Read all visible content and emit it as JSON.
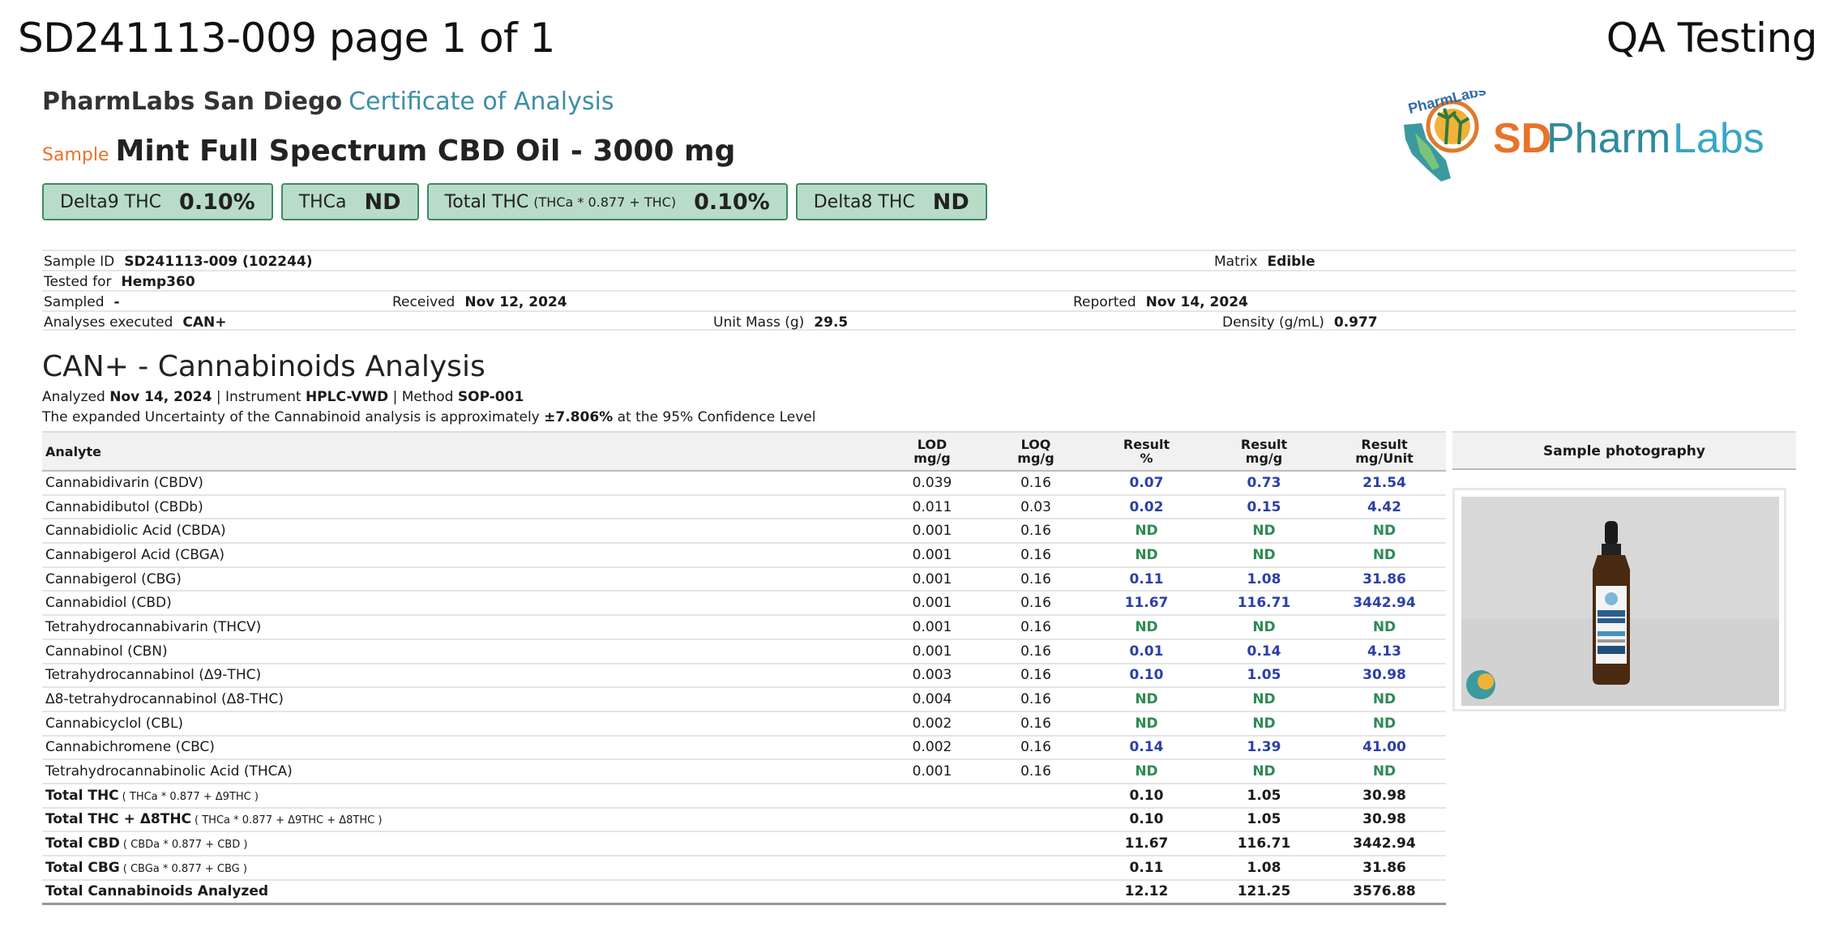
{
  "header": {
    "doc_id": "SD241113-009 page 1 of 1",
    "qa": "QA Testing"
  },
  "lab": {
    "name": "PharmLabs San Diego",
    "doc_type": "Certificate of Analysis"
  },
  "logo": {
    "text_sd": "SD",
    "text_pharm": "Pharm",
    "text_labs": "Labs",
    "small_text": "PharmLabs"
  },
  "sample": {
    "tag": "Sample",
    "name": "Mint Full Spectrum CBD Oil - 3000 mg"
  },
  "badges": [
    {
      "label": "Delta9 THC",
      "formula": "",
      "value": "0.10%"
    },
    {
      "label": "THCa",
      "formula": "",
      "value": "ND"
    },
    {
      "label": "Total THC",
      "formula": "(THCa * 0.877 + THC)",
      "value": "0.10%"
    },
    {
      "label": "Delta8 THC",
      "formula": "",
      "value": "ND"
    }
  ],
  "info": {
    "sample_id_label": "Sample ID",
    "sample_id": "SD241113-009 (102244)",
    "matrix_label": "Matrix",
    "matrix": "Edible",
    "tested_for_label": "Tested for",
    "tested_for": "Hemp360",
    "sampled_label": "Sampled",
    "sampled": "-",
    "received_label": "Received",
    "received": "Nov 12, 2024",
    "reported_label": "Reported",
    "reported": "Nov 14, 2024",
    "analyses_label": "Analyses executed",
    "analyses": "CAN+",
    "unit_mass_label": "Unit Mass (g)",
    "unit_mass": "29.5",
    "density_label": "Density (g/mL)",
    "density": "0.977"
  },
  "analysis": {
    "title": "CAN+ - Cannabinoids Analysis",
    "analyzed_label": "Analyzed",
    "analyzed": "Nov 14, 2024",
    "instrument_label": "|  Instrument",
    "instrument": "HPLC-VWD",
    "method_label": "| Method",
    "method": "SOP-001",
    "uncertainty_pre": "The expanded Uncertainty of the Cannabinoid analysis is approximately",
    "uncertainty_value": "±7.806%",
    "uncertainty_post": "at the 95% Confidence Level"
  },
  "table": {
    "headers": {
      "analyte": "Analyte",
      "lod_1": "LOD",
      "lod_2": "mg/g",
      "loq_1": "LOQ",
      "loq_2": "mg/g",
      "pct_1": "Result",
      "pct_2": "%",
      "mgg_1": "Result",
      "mgg_2": "mg/g",
      "mgu_1": "Result",
      "mgu_2": "mg/Unit",
      "photo": "Sample photography"
    },
    "rows": [
      {
        "name": "Cannabidivarin (CBDV)",
        "lod": "0.039",
        "loq": "0.16",
        "pct": "0.07",
        "mgg": "0.73",
        "mgu": "21.54"
      },
      {
        "name": "Cannabidibutol (CBDb)",
        "lod": "0.011",
        "loq": "0.03",
        "pct": "0.02",
        "mgg": "0.15",
        "mgu": "4.42"
      },
      {
        "name": "Cannabidiolic Acid (CBDA)",
        "lod": "0.001",
        "loq": "0.16",
        "pct": "ND",
        "mgg": "ND",
        "mgu": "ND"
      },
      {
        "name": "Cannabigerol Acid (CBGA)",
        "lod": "0.001",
        "loq": "0.16",
        "pct": "ND",
        "mgg": "ND",
        "mgu": "ND"
      },
      {
        "name": "Cannabigerol (CBG)",
        "lod": "0.001",
        "loq": "0.16",
        "pct": "0.11",
        "mgg": "1.08",
        "mgu": "31.86"
      },
      {
        "name": "Cannabidiol (CBD)",
        "lod": "0.001",
        "loq": "0.16",
        "pct": "11.67",
        "mgg": "116.71",
        "mgu": "3442.94"
      },
      {
        "name": "Tetrahydrocannabivarin (THCV)",
        "lod": "0.001",
        "loq": "0.16",
        "pct": "ND",
        "mgg": "ND",
        "mgu": "ND"
      },
      {
        "name": "Cannabinol (CBN)",
        "lod": "0.001",
        "loq": "0.16",
        "pct": "0.01",
        "mgg": "0.14",
        "mgu": "4.13"
      },
      {
        "name": "Tetrahydrocannabinol (Δ9-THC)",
        "lod": "0.003",
        "loq": "0.16",
        "pct": "0.10",
        "mgg": "1.05",
        "mgu": "30.98"
      },
      {
        "name": "Δ8-tetrahydrocannabinol (Δ8-THC)",
        "lod": "0.004",
        "loq": "0.16",
        "pct": "ND",
        "mgg": "ND",
        "mgu": "ND"
      },
      {
        "name": "Cannabicyclol (CBL)",
        "lod": "0.002",
        "loq": "0.16",
        "pct": "ND",
        "mgg": "ND",
        "mgu": "ND"
      },
      {
        "name": "Cannabichromene (CBC)",
        "lod": "0.002",
        "loq": "0.16",
        "pct": "0.14",
        "mgg": "1.39",
        "mgu": "41.00"
      },
      {
        "name": "Tetrahydrocannabinolic Acid (THCA)",
        "lod": "0.001",
        "loq": "0.16",
        "pct": "ND",
        "mgg": "ND",
        "mgu": "ND"
      }
    ],
    "totals": [
      {
        "name": "Total THC",
        "formula": "( THCa * 0.877 + Δ9THC )",
        "pct": "0.10",
        "mgg": "1.05",
        "mgu": "30.98"
      },
      {
        "name": "Total THC + Δ8THC",
        "formula": "( THCa * 0.877 + Δ9THC + Δ8THC )",
        "pct": "0.10",
        "mgg": "1.05",
        "mgu": "30.98"
      },
      {
        "name": "Total CBD",
        "formula": "( CBDa * 0.877 + CBD )",
        "pct": "11.67",
        "mgg": "116.71",
        "mgu": "3442.94"
      },
      {
        "name": "Total CBG",
        "formula": "( CBGa * 0.877 + CBG )",
        "pct": "0.11",
        "mgg": "1.08",
        "mgu": "31.86"
      },
      {
        "name": "Total Cannabinoids Analyzed",
        "formula": "",
        "pct": "12.12",
        "mgg": "121.25",
        "mgu": "3576.88"
      }
    ]
  },
  "colors": {
    "accent": "#3e8ea8",
    "sample_tag": "#e8732a",
    "badge_bg": "#b9dcc9",
    "badge_border": "#3f8a63",
    "value_blue": "#2b3fa8",
    "nd_green": "#2f8a55"
  }
}
